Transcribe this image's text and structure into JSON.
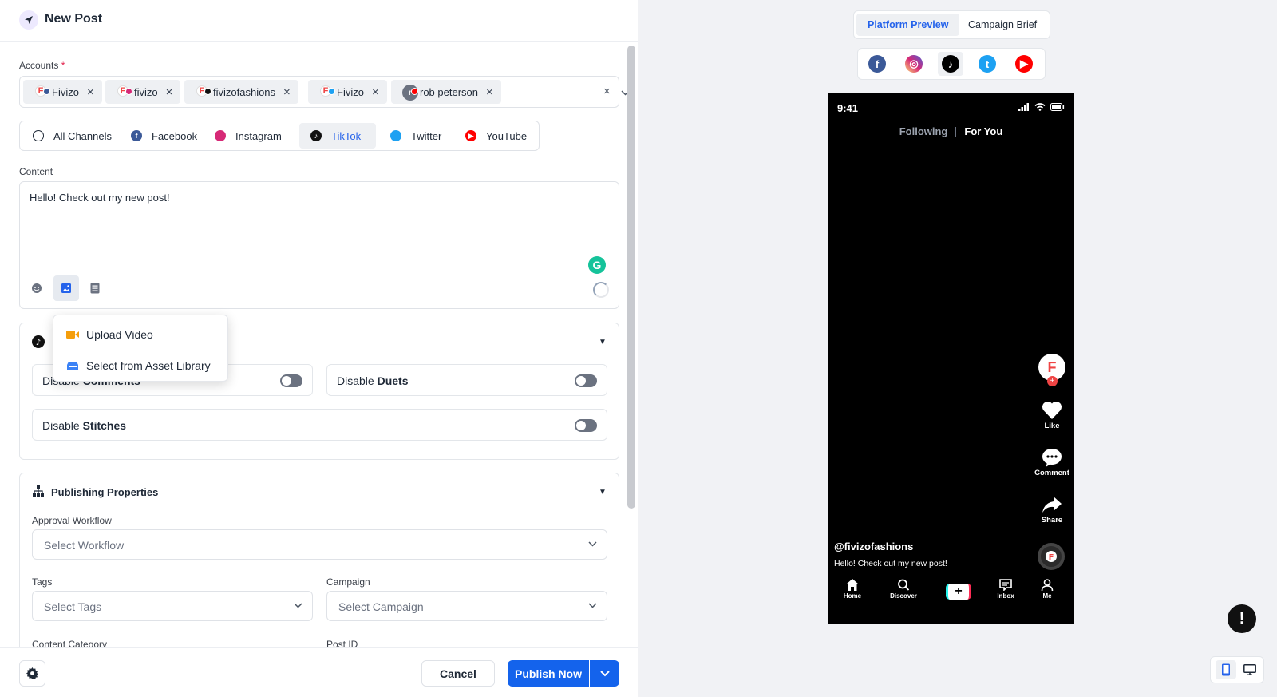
{
  "header": {
    "title": "New Post"
  },
  "accounts": {
    "label": "Accounts",
    "required_mark": "*",
    "chips": [
      {
        "name": "Fivizo",
        "platform": "facebook",
        "remove": "×"
      },
      {
        "name": "fivizo",
        "platform": "instagram",
        "remove": "×"
      },
      {
        "name": "fivizofashions",
        "platform": "tiktok",
        "remove": "×"
      },
      {
        "name": "Fivizo",
        "platform": "twitter",
        "remove": "×"
      },
      {
        "name": "rob peterson",
        "platform": "youtube",
        "avatar_initial": "r",
        "remove": "×"
      }
    ],
    "clear": "×"
  },
  "channels": [
    {
      "label": "All Channels"
    },
    {
      "label": "Facebook"
    },
    {
      "label": "Instagram"
    },
    {
      "label": "TikTok",
      "active": true
    },
    {
      "label": "Twitter"
    },
    {
      "label": "YouTube"
    }
  ],
  "content": {
    "label": "Content",
    "value": "Hello! Check out my new post!"
  },
  "media_menu": {
    "items": [
      {
        "label": "Upload Video"
      },
      {
        "label": "Select from Asset Library"
      }
    ]
  },
  "tiktok_settings": {
    "comments_prefix": "Disable ",
    "comments_bold": "Comments",
    "duets_prefix": "Disable ",
    "duets_bold": "Duets",
    "stitches_prefix": "Disable ",
    "stitches_bold": "Stitches"
  },
  "publishing": {
    "title": "Publishing Properties",
    "approval_label": "Approval Workflow",
    "approval_placeholder": "Select Workflow",
    "tags_label": "Tags",
    "tags_placeholder": "Select Tags",
    "campaign_label": "Campaign",
    "campaign_placeholder": "Select Campaign",
    "content_category_label": "Content Category",
    "post_id_label": "Post ID"
  },
  "footer": {
    "cancel": "Cancel",
    "publish": "Publish Now"
  },
  "preview": {
    "tabs": [
      {
        "label": "Platform Preview",
        "active": true
      },
      {
        "label": "Campaign Brief"
      }
    ],
    "platforms": [
      "facebook",
      "instagram",
      "tiktok",
      "twitter",
      "youtube"
    ],
    "phone": {
      "time": "9:41",
      "tab_following": "Following",
      "tab_for_you": "For You",
      "like": "Like",
      "comment": "Comment",
      "share": "Share",
      "username": "@fivizofashions",
      "caption": "Hello! Check out my new post!",
      "nav": [
        "Home",
        "Discover",
        "Inbox",
        "Me"
      ]
    }
  },
  "colors": {
    "accent": "#1463ec",
    "facebook": "#3b5998",
    "instagram": "#d62976",
    "tiktok": "#000000",
    "twitter": "#1da1f2",
    "youtube": "#ff0000"
  }
}
